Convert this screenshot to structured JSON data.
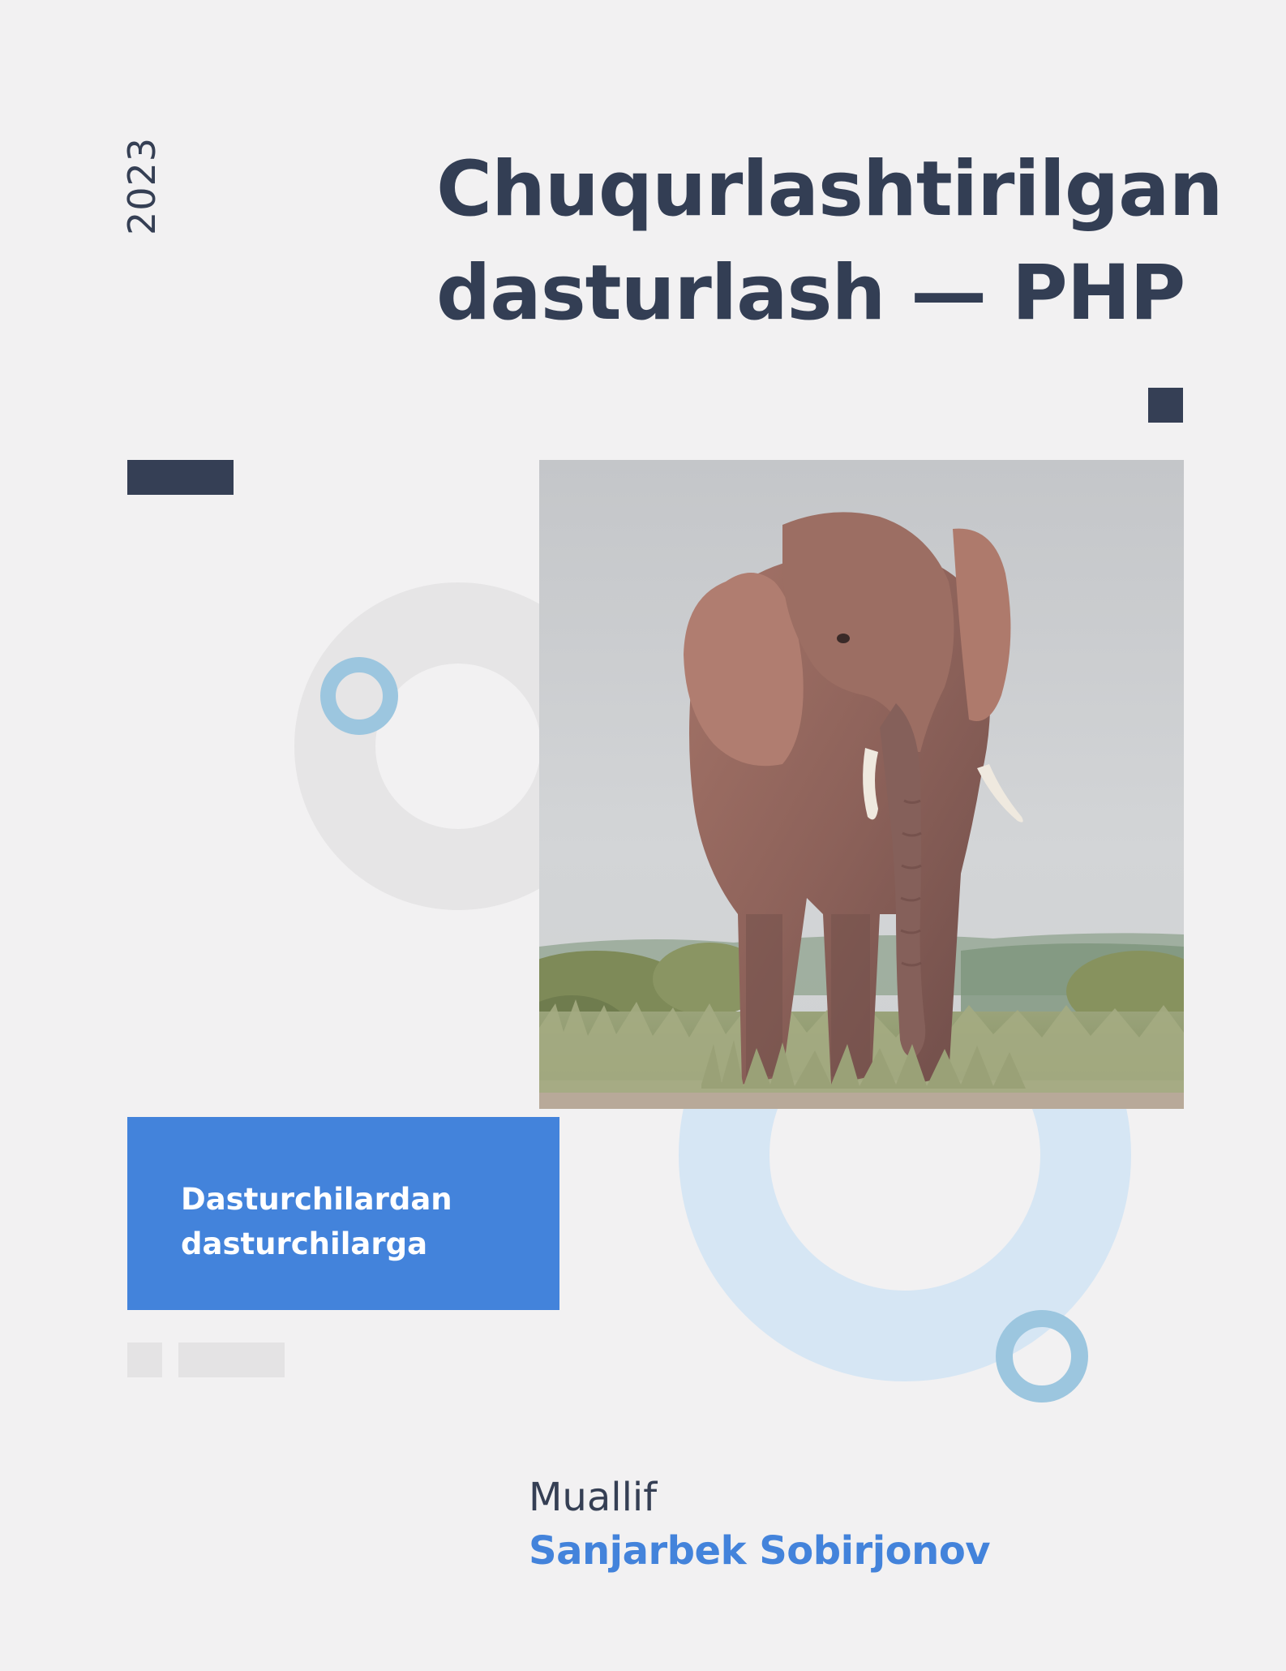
{
  "cover": {
    "year": "2023",
    "title_line1": "Chuqurlashtirilgan",
    "title_line2": "dasturlash — PHP",
    "tagline_line1": "Dasturchilardan",
    "tagline_line2": "dasturchilarga",
    "author_label": "Muallif",
    "author_name": "Sanjarbek Sobirjonov",
    "cover_image": "elephant-photo"
  },
  "colors": {
    "background": "#f2f1f2",
    "dark_navy": "#333e54",
    "accent_blue": "#4383db",
    "light_blue_ring": "#d6e6f4",
    "small_ring_blue": "#9cc6df",
    "gray_ring": "#e6e5e6"
  }
}
